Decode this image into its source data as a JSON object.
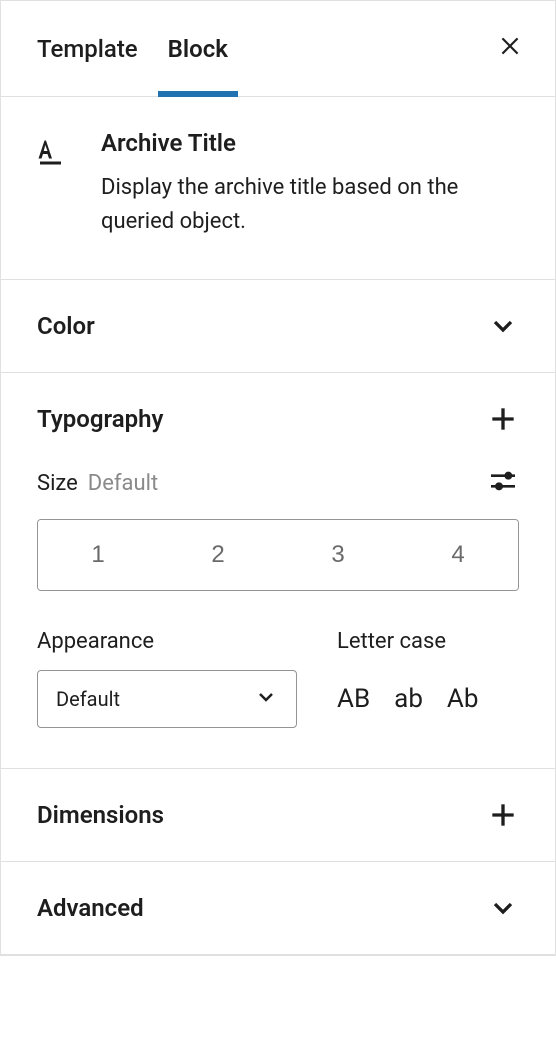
{
  "tabs": {
    "template": "Template",
    "block": "Block"
  },
  "block": {
    "title": "Archive Title",
    "description": "Display the archive title based on the queried object."
  },
  "sections": {
    "color": "Color",
    "typography": "Typography",
    "dimensions": "Dimensions",
    "advanced": "Advanced"
  },
  "typography": {
    "size_label": "Size",
    "size_default": "Default",
    "sizes": [
      "1",
      "2",
      "3",
      "4"
    ],
    "appearance_label": "Appearance",
    "appearance_value": "Default",
    "lettercase_label": "Letter case",
    "lettercase_options": [
      "AB",
      "ab",
      "Ab"
    ]
  }
}
